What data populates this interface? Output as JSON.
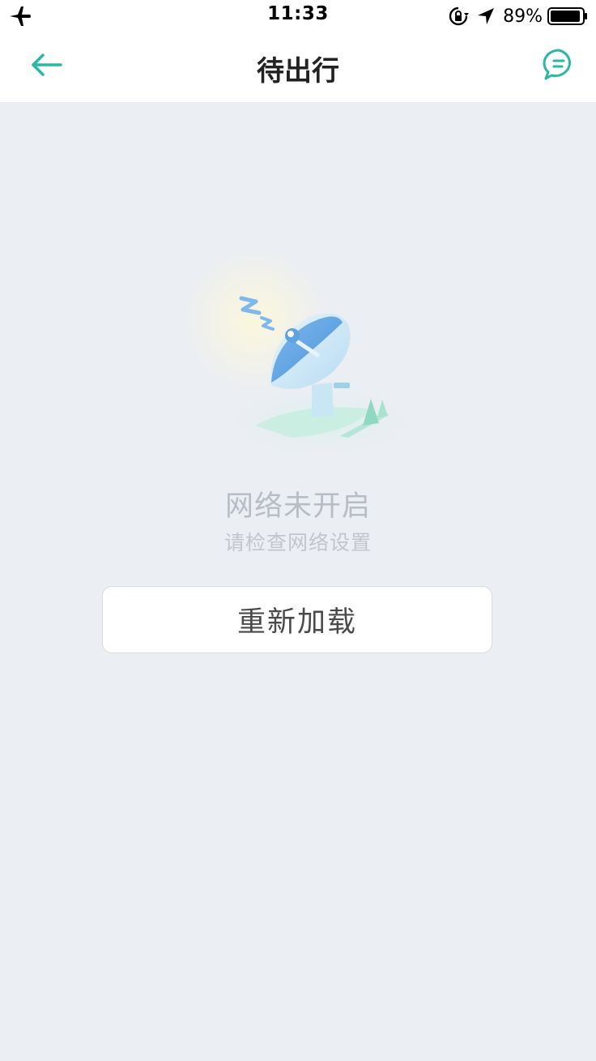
{
  "status_bar": {
    "time": "11:33",
    "battery_percent": "89%",
    "icons": [
      "airplane-icon",
      "rotation-lock-icon",
      "location-arrow-icon",
      "battery-icon"
    ]
  },
  "nav": {
    "title": "待出行",
    "back_icon": "arrow-left-icon",
    "message_icon": "chat-bubble-icon",
    "accent_color": "#2bb8a3"
  },
  "empty_state": {
    "illustration": "sleeping-satellite-dish-illustration",
    "title": "网络未开启",
    "subtitle": "请检查网络设置",
    "reload_label": "重新加载"
  }
}
